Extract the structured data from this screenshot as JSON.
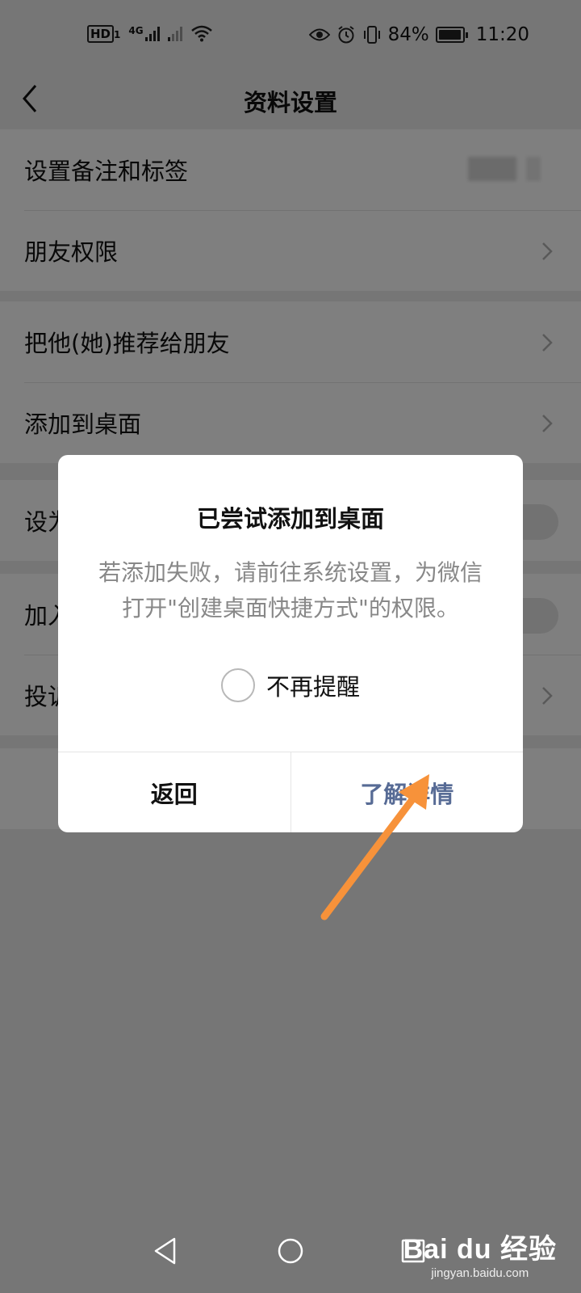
{
  "status_bar": {
    "hd_label": "HD",
    "hd_sim": "1",
    "network": "4G",
    "battery_percent": "84%",
    "battery_level": 0.84,
    "time": "11:20"
  },
  "header": {
    "title": "资料设置",
    "back_icon": "chevron-left-icon"
  },
  "groups": [
    {
      "items": [
        {
          "label": "设置备注和标签",
          "trailing": "blurred-value"
        },
        {
          "label": "朋友权限",
          "trailing": "chevron"
        }
      ]
    },
    {
      "items": [
        {
          "label": "把他(她)推荐给朋友",
          "trailing": "chevron"
        },
        {
          "label": "添加到桌面",
          "trailing": "chevron"
        }
      ]
    },
    {
      "items": [
        {
          "label": "设为星标朋友",
          "trailing": "toggle"
        }
      ]
    },
    {
      "items": [
        {
          "label": "加入黑名单",
          "trailing": "toggle"
        },
        {
          "label": "投诉",
          "trailing": "chevron"
        }
      ]
    }
  ],
  "dialog": {
    "title": "已尝试添加到桌面",
    "message": "若添加失败，请前往系统设置，为微信打开\"创建桌面快捷方式\"的权限。",
    "remind_label": "不再提醒",
    "back_button": "返回",
    "details_button": "了解详情"
  },
  "annotation": {
    "arrow_color": "#f7923a"
  },
  "colors": {
    "link_blue": "#576b95",
    "overlay": "rgba(0,0,0,0.5)"
  },
  "watermark": {
    "brand": "Bai du 经验",
    "url": "jingyan.baidu.com"
  }
}
